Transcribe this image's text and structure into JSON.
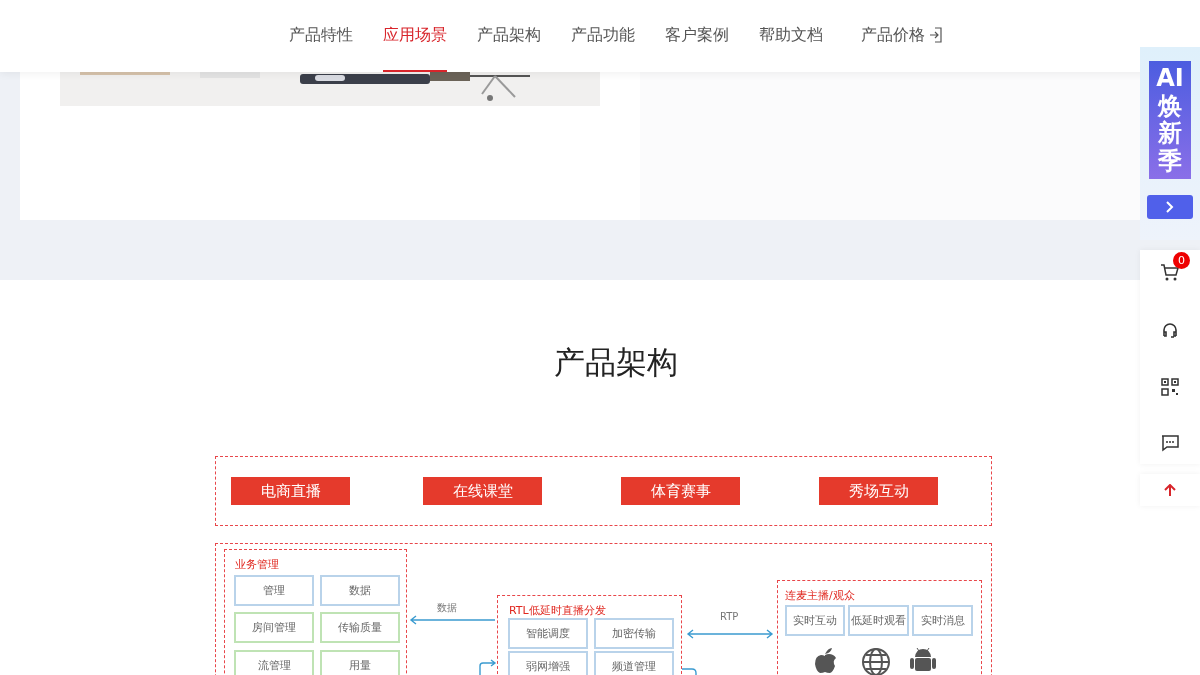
{
  "nav": {
    "items": [
      {
        "label": "产品特性",
        "selected": false
      },
      {
        "label": "应用场景",
        "selected": true
      },
      {
        "label": "产品架构",
        "selected": false
      },
      {
        "label": "产品功能",
        "selected": false
      },
      {
        "label": "客户案例",
        "selected": false
      },
      {
        "label": "帮助文档",
        "selected": false
      },
      {
        "label": "产品价格",
        "selected": false
      }
    ]
  },
  "section": {
    "title": "产品架构"
  },
  "diagram": {
    "scenarios": [
      "电商直播",
      "在线课堂",
      "体育赛事",
      "秀场互动"
    ],
    "business": {
      "title": "业务管理",
      "cells": [
        {
          "label": "管理",
          "color": "#b9d3ea"
        },
        {
          "label": "数据",
          "color": "#b9d3ea"
        },
        {
          "label": "房间管理",
          "color": "#bfe3b4"
        },
        {
          "label": "传输质量",
          "color": "#bfe3b4"
        },
        {
          "label": "流管理",
          "color": "#bfe3b4"
        },
        {
          "label": "用量",
          "color": "#bfe3b4"
        }
      ]
    },
    "rtl": {
      "title": "RTL低延时直播分发",
      "cells": [
        "智能调度",
        "加密传输",
        "弱网增强",
        "频道管理"
      ]
    },
    "client": {
      "title": "连麦主播/观众",
      "cells": [
        "实时互动",
        "低延时观看",
        "实时消息"
      ]
    },
    "data_label": "数据",
    "rtp_label": "RTP"
  },
  "side": {
    "banner_lines": [
      "AI",
      "焕",
      "新",
      "季"
    ],
    "cart_count": "0"
  }
}
